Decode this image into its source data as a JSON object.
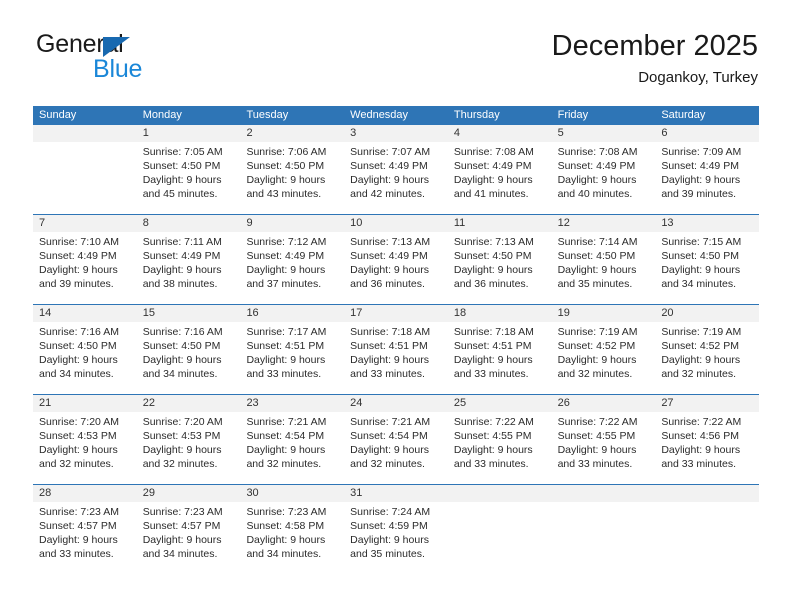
{
  "brand": {
    "name_part1": "General",
    "name_part2": "Blue",
    "triangle_color": "#1869b0",
    "blue_color": "#1a87d8"
  },
  "header": {
    "title": "December 2025",
    "subtitle": "Dogankoy, Turkey"
  },
  "theme": {
    "header_row_bg": "#2e75b6",
    "daynum_row_bg": "#f2f2f2",
    "week_separator": "#2e75b6"
  },
  "weekdays": [
    "Sunday",
    "Monday",
    "Tuesday",
    "Wednesday",
    "Thursday",
    "Friday",
    "Saturday"
  ],
  "weeks": [
    {
      "days": [
        {
          "num": "",
          "lines": [
            "",
            "",
            "",
            ""
          ]
        },
        {
          "num": "1",
          "lines": [
            "Sunrise: 7:05 AM",
            "Sunset: 4:50 PM",
            "Daylight: 9 hours",
            "and 45 minutes."
          ]
        },
        {
          "num": "2",
          "lines": [
            "Sunrise: 7:06 AM",
            "Sunset: 4:50 PM",
            "Daylight: 9 hours",
            "and 43 minutes."
          ]
        },
        {
          "num": "3",
          "lines": [
            "Sunrise: 7:07 AM",
            "Sunset: 4:49 PM",
            "Daylight: 9 hours",
            "and 42 minutes."
          ]
        },
        {
          "num": "4",
          "lines": [
            "Sunrise: 7:08 AM",
            "Sunset: 4:49 PM",
            "Daylight: 9 hours",
            "and 41 minutes."
          ]
        },
        {
          "num": "5",
          "lines": [
            "Sunrise: 7:08 AM",
            "Sunset: 4:49 PM",
            "Daylight: 9 hours",
            "and 40 minutes."
          ]
        },
        {
          "num": "6",
          "lines": [
            "Sunrise: 7:09 AM",
            "Sunset: 4:49 PM",
            "Daylight: 9 hours",
            "and 39 minutes."
          ]
        }
      ]
    },
    {
      "days": [
        {
          "num": "7",
          "lines": [
            "Sunrise: 7:10 AM",
            "Sunset: 4:49 PM",
            "Daylight: 9 hours",
            "and 39 minutes."
          ]
        },
        {
          "num": "8",
          "lines": [
            "Sunrise: 7:11 AM",
            "Sunset: 4:49 PM",
            "Daylight: 9 hours",
            "and 38 minutes."
          ]
        },
        {
          "num": "9",
          "lines": [
            "Sunrise: 7:12 AM",
            "Sunset: 4:49 PM",
            "Daylight: 9 hours",
            "and 37 minutes."
          ]
        },
        {
          "num": "10",
          "lines": [
            "Sunrise: 7:13 AM",
            "Sunset: 4:49 PM",
            "Daylight: 9 hours",
            "and 36 minutes."
          ]
        },
        {
          "num": "11",
          "lines": [
            "Sunrise: 7:13 AM",
            "Sunset: 4:50 PM",
            "Daylight: 9 hours",
            "and 36 minutes."
          ]
        },
        {
          "num": "12",
          "lines": [
            "Sunrise: 7:14 AM",
            "Sunset: 4:50 PM",
            "Daylight: 9 hours",
            "and 35 minutes."
          ]
        },
        {
          "num": "13",
          "lines": [
            "Sunrise: 7:15 AM",
            "Sunset: 4:50 PM",
            "Daylight: 9 hours",
            "and 34 minutes."
          ]
        }
      ]
    },
    {
      "days": [
        {
          "num": "14",
          "lines": [
            "Sunrise: 7:16 AM",
            "Sunset: 4:50 PM",
            "Daylight: 9 hours",
            "and 34 minutes."
          ]
        },
        {
          "num": "15",
          "lines": [
            "Sunrise: 7:16 AM",
            "Sunset: 4:50 PM",
            "Daylight: 9 hours",
            "and 34 minutes."
          ]
        },
        {
          "num": "16",
          "lines": [
            "Sunrise: 7:17 AM",
            "Sunset: 4:51 PM",
            "Daylight: 9 hours",
            "and 33 minutes."
          ]
        },
        {
          "num": "17",
          "lines": [
            "Sunrise: 7:18 AM",
            "Sunset: 4:51 PM",
            "Daylight: 9 hours",
            "and 33 minutes."
          ]
        },
        {
          "num": "18",
          "lines": [
            "Sunrise: 7:18 AM",
            "Sunset: 4:51 PM",
            "Daylight: 9 hours",
            "and 33 minutes."
          ]
        },
        {
          "num": "19",
          "lines": [
            "Sunrise: 7:19 AM",
            "Sunset: 4:52 PM",
            "Daylight: 9 hours",
            "and 32 minutes."
          ]
        },
        {
          "num": "20",
          "lines": [
            "Sunrise: 7:19 AM",
            "Sunset: 4:52 PM",
            "Daylight: 9 hours",
            "and 32 minutes."
          ]
        }
      ]
    },
    {
      "days": [
        {
          "num": "21",
          "lines": [
            "Sunrise: 7:20 AM",
            "Sunset: 4:53 PM",
            "Daylight: 9 hours",
            "and 32 minutes."
          ]
        },
        {
          "num": "22",
          "lines": [
            "Sunrise: 7:20 AM",
            "Sunset: 4:53 PM",
            "Daylight: 9 hours",
            "and 32 minutes."
          ]
        },
        {
          "num": "23",
          "lines": [
            "Sunrise: 7:21 AM",
            "Sunset: 4:54 PM",
            "Daylight: 9 hours",
            "and 32 minutes."
          ]
        },
        {
          "num": "24",
          "lines": [
            "Sunrise: 7:21 AM",
            "Sunset: 4:54 PM",
            "Daylight: 9 hours",
            "and 32 minutes."
          ]
        },
        {
          "num": "25",
          "lines": [
            "Sunrise: 7:22 AM",
            "Sunset: 4:55 PM",
            "Daylight: 9 hours",
            "and 33 minutes."
          ]
        },
        {
          "num": "26",
          "lines": [
            "Sunrise: 7:22 AM",
            "Sunset: 4:55 PM",
            "Daylight: 9 hours",
            "and 33 minutes."
          ]
        },
        {
          "num": "27",
          "lines": [
            "Sunrise: 7:22 AM",
            "Sunset: 4:56 PM",
            "Daylight: 9 hours",
            "and 33 minutes."
          ]
        }
      ]
    },
    {
      "days": [
        {
          "num": "28",
          "lines": [
            "Sunrise: 7:23 AM",
            "Sunset: 4:57 PM",
            "Daylight: 9 hours",
            "and 33 minutes."
          ]
        },
        {
          "num": "29",
          "lines": [
            "Sunrise: 7:23 AM",
            "Sunset: 4:57 PM",
            "Daylight: 9 hours",
            "and 34 minutes."
          ]
        },
        {
          "num": "30",
          "lines": [
            "Sunrise: 7:23 AM",
            "Sunset: 4:58 PM",
            "Daylight: 9 hours",
            "and 34 minutes."
          ]
        },
        {
          "num": "31",
          "lines": [
            "Sunrise: 7:24 AM",
            "Sunset: 4:59 PM",
            "Daylight: 9 hours",
            "and 35 minutes."
          ]
        },
        {
          "num": "",
          "lines": [
            "",
            "",
            "",
            ""
          ]
        },
        {
          "num": "",
          "lines": [
            "",
            "",
            "",
            ""
          ]
        },
        {
          "num": "",
          "lines": [
            "",
            "",
            "",
            ""
          ]
        }
      ]
    }
  ]
}
